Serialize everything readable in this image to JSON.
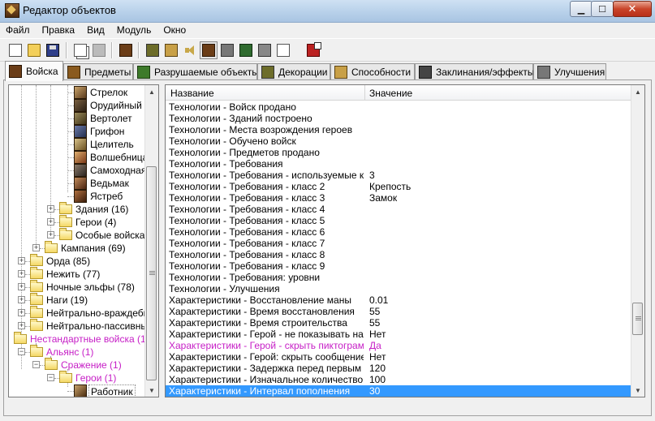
{
  "window": {
    "title": "Редактор объектов"
  },
  "menu": [
    "Файл",
    "Правка",
    "Вид",
    "Модуль",
    "Окно"
  ],
  "tabs": [
    {
      "label": "Войска",
      "icon": "peasant-unit-icon",
      "active": true
    },
    {
      "label": "Предметы",
      "icon": "chest-icon",
      "active": false
    },
    {
      "label": "Разрушаемые объекты",
      "icon": "tree-icon",
      "active": false
    },
    {
      "label": "Декорации",
      "icon": "doodad-icon",
      "active": false
    },
    {
      "label": "Способности",
      "icon": "ability-icon",
      "active": false
    },
    {
      "label": "Заклинания/эффекты",
      "icon": "buff-icon",
      "active": false
    },
    {
      "label": "Улучшения",
      "icon": "shield-icon",
      "active": false
    }
  ],
  "tree": [
    {
      "label": "Стрелок",
      "icon": "unit-icon"
    },
    {
      "label": "Орудийный ра",
      "icon": "unit-icon"
    },
    {
      "label": "Вертолет",
      "icon": "unit-icon"
    },
    {
      "label": "Грифон",
      "icon": "unit-icon"
    },
    {
      "label": "Целитель",
      "icon": "unit-icon"
    },
    {
      "label": "Волшебница",
      "icon": "unit-icon"
    },
    {
      "label": "Самоходная м",
      "icon": "unit-icon"
    },
    {
      "label": "Ведьмак",
      "icon": "unit-icon"
    },
    {
      "label": "Ястреб",
      "icon": "unit-icon"
    },
    {
      "label": "Здания (16)",
      "icon": "folder-icon"
    },
    {
      "label": "Герои (4)",
      "icon": "folder-icon"
    },
    {
      "label": "Особые войска (",
      "icon": "folder-icon"
    },
    {
      "label": "Кампания (69)",
      "icon": "folder-icon"
    },
    {
      "label": "Орда (85)",
      "icon": "folder-icon"
    },
    {
      "label": "Нежить (77)",
      "icon": "folder-icon"
    },
    {
      "label": "Ночные эльфы (78)",
      "icon": "folder-icon"
    },
    {
      "label": "Наги (19)",
      "icon": "folder-icon"
    },
    {
      "label": "Нейтрально-враждебные",
      "icon": "folder-icon"
    },
    {
      "label": "Нейтрально-пассивные (",
      "icon": "folder-icon"
    },
    {
      "label": "Нестандартные войска (1)",
      "icon": "folder-icon"
    },
    {
      "label": "Альянс (1)",
      "icon": "folder-icon"
    },
    {
      "label": "Сражение (1)",
      "icon": "folder-icon"
    },
    {
      "label": "Герои (1)",
      "icon": "folder-icon"
    },
    {
      "label": "Работник",
      "icon": "unit-icon"
    }
  ],
  "table": {
    "columns": [
      "Название",
      "Значение"
    ],
    "rows": [
      {
        "name": "Технологии - Войск продано",
        "value": ""
      },
      {
        "name": "Технологии - Зданий построено",
        "value": ""
      },
      {
        "name": "Технологии - Места возрождения героев",
        "value": ""
      },
      {
        "name": "Технологии - Обучено войск",
        "value": ""
      },
      {
        "name": "Технологии - Предметов продано",
        "value": ""
      },
      {
        "name": "Технологии - Требования",
        "value": ""
      },
      {
        "name": "Технологии - Требования - используемые кл...",
        "value": "3"
      },
      {
        "name": "Технологии - Требования - класс 2",
        "value": "Крепость"
      },
      {
        "name": "Технологии - Требования - класс 3",
        "value": "Замок"
      },
      {
        "name": "Технологии - Требования - класс 4",
        "value": ""
      },
      {
        "name": "Технологии - Требования - класс 5",
        "value": ""
      },
      {
        "name": "Технологии - Требования - класс 6",
        "value": ""
      },
      {
        "name": "Технологии - Требования - класс 7",
        "value": ""
      },
      {
        "name": "Технологии - Требования - класс 8",
        "value": ""
      },
      {
        "name": "Технологии - Требования - класс 9",
        "value": ""
      },
      {
        "name": "Технологии - Требования: уровни",
        "value": ""
      },
      {
        "name": "Технологии - Улучшения",
        "value": ""
      },
      {
        "name": "Характеристики - Восстановление маны",
        "value": "0.01"
      },
      {
        "name": "Характеристики - Время восстановления",
        "value": "55"
      },
      {
        "name": "Характеристики - Время строительства",
        "value": "55"
      },
      {
        "name": "Характеристики - Герой - не показывать на ...",
        "value": "Нет"
      },
      {
        "name": "Характеристики - Герой - скрыть пиктограм...",
        "value": "Да"
      },
      {
        "name": "Характеристики - Герой: скрыть сообщение ...",
        "value": "Нет"
      },
      {
        "name": "Характеристики - Задержка перед первым п...",
        "value": "120"
      },
      {
        "name": "Характеристики - Изначальное количество ...",
        "value": "100"
      },
      {
        "name": "Характеристики - Интервал пополнения",
        "value": "30"
      }
    ]
  }
}
